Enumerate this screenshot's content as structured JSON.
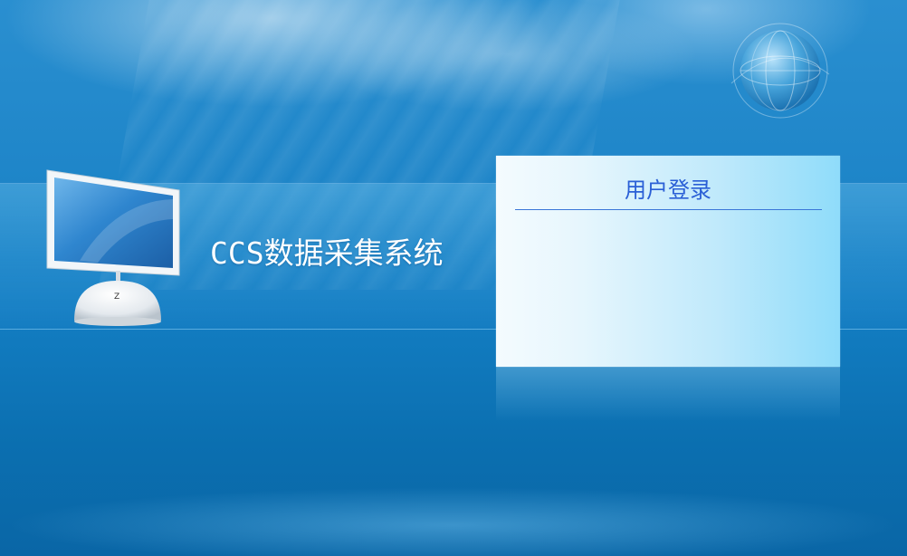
{
  "app": {
    "title": "CCS数据采集系统"
  },
  "login": {
    "title": "用户登录"
  },
  "colors": {
    "background_top": "#2a8fd0",
    "background_bottom": "#0a66a6",
    "login_title": "#2a5fd6",
    "login_divider": "#3a76d8",
    "app_title": "#ffffff"
  },
  "icons": {
    "monitor": "computer-monitor-icon",
    "globe": "globe-icon"
  }
}
